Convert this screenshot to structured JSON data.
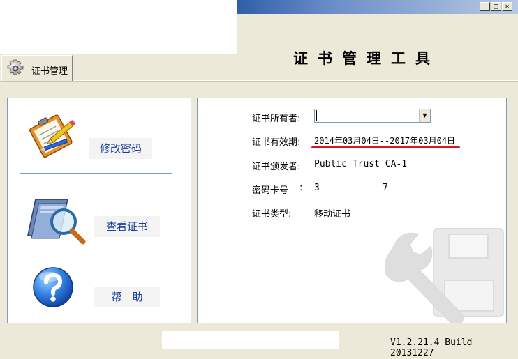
{
  "window": {
    "title": "证书管理工具",
    "controls": {
      "minimize": "_",
      "maximize": "□",
      "close": "×"
    }
  },
  "tab": {
    "label": "证书管理",
    "icon": "gear-icon"
  },
  "actions": [
    {
      "label": "修改密码",
      "icon": "clipboard-pencil-icon"
    },
    {
      "label": "查看证书",
      "icon": "magnifier-book-icon"
    },
    {
      "label": "帮　助",
      "icon": "question-icon"
    }
  ],
  "details": {
    "owner_label": "证书所有者:",
    "owner_value": "",
    "validity_label": "证书有效期:",
    "validity_value": "2014年03月04日--2017年03月04日",
    "issuer_label": "证书颁发者:",
    "issuer_value": "Public Trust CA-1",
    "card_label": "密码卡号",
    "card_sep": ":",
    "card_value_1": "3",
    "card_value_2": "7",
    "type_label": "证书类型:",
    "type_value": "移动证书"
  },
  "footer": {
    "version": "V1.2.21.4 Build 20131227"
  },
  "colors": {
    "accent_blue": "#1a3f9e",
    "highlight_red": "#e0141e",
    "panel_border": "#7f9db9"
  }
}
